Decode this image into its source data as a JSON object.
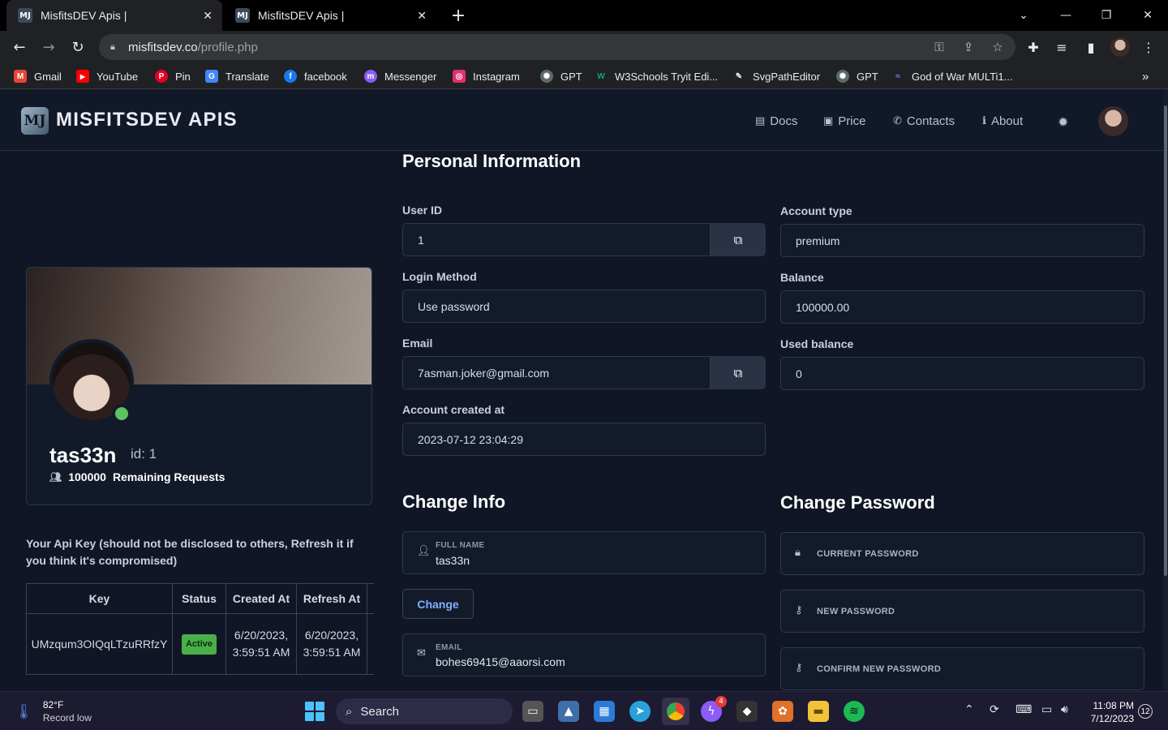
{
  "browser": {
    "tabs": [
      {
        "title": "MisfitsDEV Apis |",
        "favicon": "MJ"
      },
      {
        "title": "MisfitsDEV Apis |",
        "favicon": "MJ"
      }
    ],
    "new_tab": "+",
    "url_host": "misfitsdev.co",
    "url_path": "/profile.php",
    "bookmarks": [
      {
        "label": "Gmail",
        "icon": "M",
        "color": "#ea4335"
      },
      {
        "label": "YouTube",
        "icon": "▶",
        "color": "#ff0000"
      },
      {
        "label": "Pin",
        "icon": "P",
        "color": "#e60023"
      },
      {
        "label": "Translate",
        "icon": "G",
        "color": "#4285f4"
      },
      {
        "label": "facebook",
        "icon": "f",
        "color": "#1877f2"
      },
      {
        "label": "Messenger",
        "icon": "m",
        "color": "#8b5cf6"
      },
      {
        "label": "Instagram",
        "icon": "◎",
        "color": "#e1306c"
      },
      {
        "label": "GPT",
        "icon": "✺",
        "color": "#5a6a64"
      },
      {
        "label": "W3Schools Tryit Edi...",
        "icon": "W",
        "color": "#04aa6d"
      },
      {
        "label": "SvgPathEditor",
        "icon": "✎",
        "color": "#202124"
      },
      {
        "label": "GPT",
        "icon": "✺",
        "color": "#5a6a64"
      },
      {
        "label": "God of War MULTi1...",
        "icon": "≈",
        "color": "#3b5bdb"
      }
    ],
    "bookmarks_more": "»"
  },
  "site": {
    "logo_mark": "MJ",
    "logo_text": "MISFITSDEV APIS",
    "nav": [
      {
        "label": "Docs",
        "icon": "▤"
      },
      {
        "label": "Price",
        "icon": "▣"
      },
      {
        "label": "Contacts",
        "icon": "✆"
      },
      {
        "label": "About",
        "icon": "ℹ"
      }
    ],
    "theme_icon": "✹"
  },
  "profile": {
    "username": "tas33n",
    "id_text": "id: 1",
    "remaining_count": "100000",
    "remaining_label": "Remaining Requests"
  },
  "api_key": {
    "note": "Your Api Key (should not be disclosed to others, Refresh it if you think it's compromised)",
    "headers": [
      "Key",
      "Status",
      "Created At",
      "Refresh At"
    ],
    "row": {
      "key": "UMzqum3OIQqLTzuRRfzY",
      "status": "Active",
      "created_at": "6/20/2023, 3:59:51 AM",
      "refresh_at": "6/20/2023, 3:59:51 AM"
    }
  },
  "personal": {
    "title": "Personal Information",
    "user_id_label": "User ID",
    "user_id": "1",
    "login_method_label": "Login Method",
    "login_method": "Use password",
    "email_label": "Email",
    "email": "7asman.joker@gmail.com",
    "created_label": "Account created at",
    "created": "2023-07-12 23:04:29",
    "account_type_label": "Account type",
    "account_type": "premium",
    "balance_label": "Balance",
    "balance": "100000.00",
    "used_balance_label": "Used balance",
    "used_balance": "0"
  },
  "change_info": {
    "title": "Change Info",
    "full_name_label": "FULL NAME",
    "full_name": "tas33n",
    "change_button": "Change",
    "email_label": "EMAIL",
    "email": "bohes69415@aaorsi.com"
  },
  "change_password": {
    "title": "Change Password",
    "current": "CURRENT PASSWORD",
    "new": "NEW PASSWORD",
    "confirm": "CONFIRM NEW PASSWORD"
  },
  "taskbar": {
    "temperature": "82°F",
    "weather_text": "Record low",
    "search_label": "Search",
    "time": "11:08 PM",
    "date": "7/12/2023",
    "notifications": "12",
    "messenger_badge": "4"
  }
}
